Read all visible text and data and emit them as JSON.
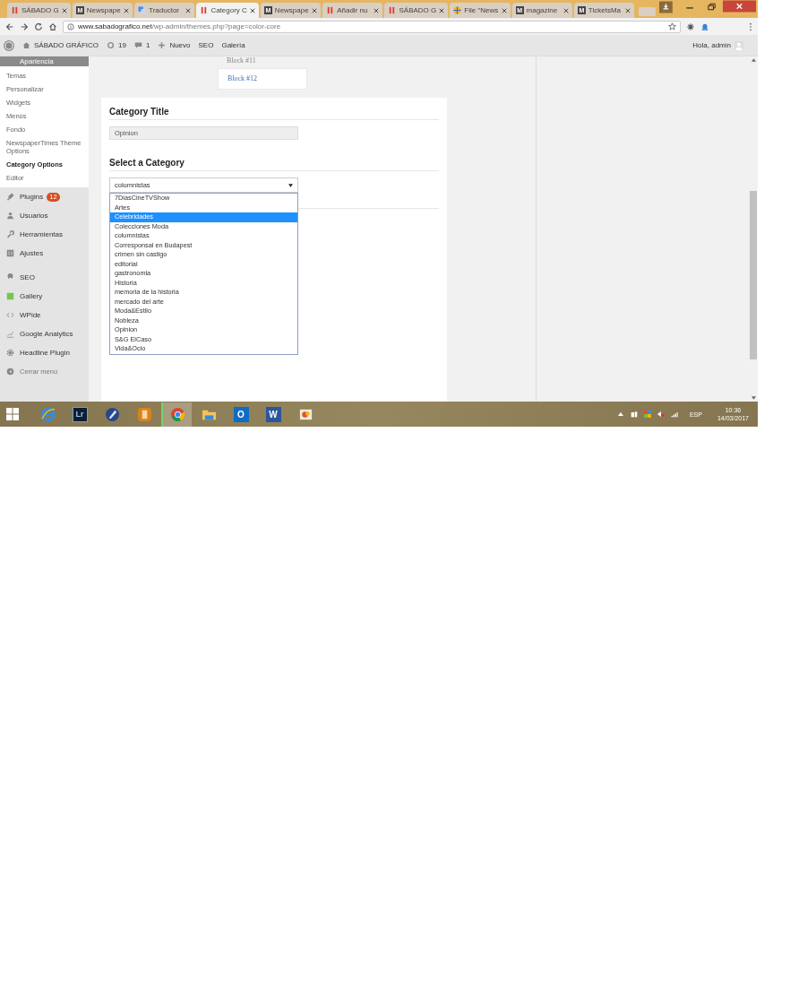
{
  "tabs": [
    {
      "kind": "bars",
      "title": "SÁBADO G",
      "selected": false
    },
    {
      "kind": "letter",
      "icon_text": "M",
      "title": "Newspape",
      "selected": false
    },
    {
      "kind": "translate",
      "title": "Traductor",
      "selected": false
    },
    {
      "kind": "bars",
      "title": "Category C",
      "selected": true
    },
    {
      "kind": "letter",
      "icon_text": "M",
      "title": "Newspape",
      "selected": false
    },
    {
      "kind": "bars",
      "title": "Añadir nu",
      "selected": false
    },
    {
      "kind": "bars",
      "title": "SÁBADO G",
      "selected": false
    },
    {
      "kind": "globe",
      "title": "File \"News",
      "selected": false
    },
    {
      "kind": "letter",
      "icon_text": "M",
      "title": "magazine",
      "selected": false
    },
    {
      "kind": "letter",
      "icon_text": "M",
      "title": "TicketsMa",
      "selected": false
    }
  ],
  "address": {
    "domain": "www.sabadografico.net",
    "path": "/wp-admin/themes.php?page=color-core"
  },
  "admin_bar": {
    "site": "SÁBADO GRÁFICO",
    "updates": "19",
    "comments": "1",
    "new": "Nuevo",
    "links": [
      "SEO",
      "Galería"
    ],
    "greeting": "Hola, admin"
  },
  "sidebar": {
    "section": "Apariencia",
    "submenu": [
      {
        "label": "Temas",
        "selected": false
      },
      {
        "label": "Personalizar",
        "selected": false
      },
      {
        "label": "Widgets",
        "selected": false
      },
      {
        "label": "Menús",
        "selected": false
      },
      {
        "label": "Fondo",
        "selected": false
      },
      {
        "label": "NewspaperTimes Theme Options",
        "selected": false
      },
      {
        "label": "Category Options",
        "selected": true
      },
      {
        "label": "Editor",
        "selected": false
      }
    ],
    "menu": [
      {
        "kind": "plugin",
        "label": "Plugins",
        "badge": "12"
      },
      {
        "kind": "users",
        "label": "Usuarios"
      },
      {
        "kind": "tools",
        "label": "Herramientas"
      },
      {
        "kind": "settings",
        "label": "Ajustes"
      },
      {
        "kind": "seo",
        "label": "SEO"
      },
      {
        "kind": "gallery",
        "label": "Gallery"
      },
      {
        "kind": "code",
        "label": "WPide"
      },
      {
        "kind": "chart",
        "label": "Google Analytics"
      },
      {
        "kind": "gear",
        "label": "Headline Plugin"
      },
      {
        "kind": "collapse",
        "label": "Cerrar menú"
      }
    ]
  },
  "blocks": [
    {
      "label": "Block #11",
      "selected": false
    },
    {
      "label": "Block #12",
      "selected": true
    }
  ],
  "form": {
    "title_heading": "Category Title",
    "title_value": "Opinion",
    "select_heading": "Select a Category",
    "select_value": "columnistas",
    "options": [
      {
        "label": "7DiasCineTVShow",
        "selected": false
      },
      {
        "label": "Artes",
        "selected": false
      },
      {
        "label": "Celebridades",
        "selected": true
      },
      {
        "label": "Colecciones Moda",
        "selected": false
      },
      {
        "label": "columnistas",
        "selected": false
      },
      {
        "label": "Corresponsal en Budapest",
        "selected": false
      },
      {
        "label": "crimen sin castigo",
        "selected": false
      },
      {
        "label": "editorial",
        "selected": false
      },
      {
        "label": "gastronomia",
        "selected": false
      },
      {
        "label": "Historia",
        "selected": false
      },
      {
        "label": "memoria de la historia",
        "selected": false
      },
      {
        "label": "mercado del arte",
        "selected": false
      },
      {
        "label": "Moda&Estilo",
        "selected": false
      },
      {
        "label": "Nobleza",
        "selected": false
      },
      {
        "label": "Opinion",
        "selected": false
      },
      {
        "label": "S&G ElCaso",
        "selected": false
      },
      {
        "label": "Vida&Ocio",
        "selected": false
      }
    ]
  },
  "taskbar": {
    "apps": [
      {
        "kind": "ie",
        "selected": false
      },
      {
        "kind": "lightroom",
        "icon_text": "Lr",
        "selected": false
      },
      {
        "kind": "pen",
        "selected": false
      },
      {
        "kind": "orange",
        "selected": false
      },
      {
        "kind": "chrome",
        "selected": true
      },
      {
        "kind": "folder",
        "selected": false
      },
      {
        "kind": "outlook",
        "icon_text": "O",
        "selected": false
      },
      {
        "kind": "word",
        "icon_text": "W",
        "selected": false
      },
      {
        "kind": "paint",
        "selected": false
      }
    ],
    "language": "ESP",
    "time": "10:36",
    "date": "14/03/2017"
  }
}
